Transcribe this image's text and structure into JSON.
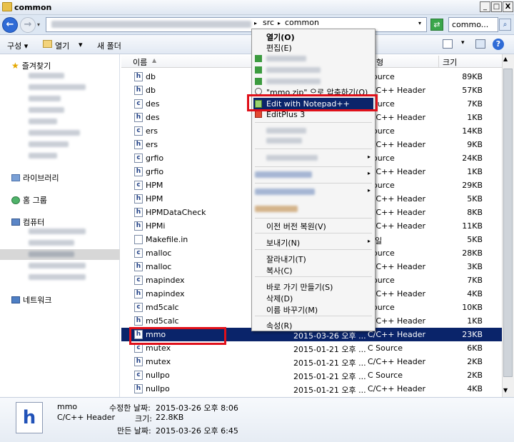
{
  "window": {
    "title": "common",
    "min": "_",
    "max": "□",
    "close": "X"
  },
  "address": {
    "crumb_src": "src",
    "crumb_common": "common",
    "search": "commo..."
  },
  "toolbar": {
    "organize": "구성 ▾",
    "open": "열기",
    "open_arrow": "▾",
    "new_folder": "새 폴더"
  },
  "sidebar": {
    "favorites": "즐겨찾기",
    "libraries": "라이브러리",
    "homegroup": "홈 그룹",
    "computer": "컴퓨터",
    "network": "네트워크"
  },
  "columns": {
    "name": "이름",
    "type": "형",
    "size": "크기"
  },
  "files": [
    {
      "icon": "h",
      "name": "db",
      "date": "",
      "type": "Source",
      "size": "89KB"
    },
    {
      "icon": "h",
      "name": "db",
      "date": "",
      "type": "C/C++ Header",
      "size": "57KB"
    },
    {
      "icon": "c",
      "name": "des",
      "date": "",
      "type": "Source",
      "size": "7KB"
    },
    {
      "icon": "h",
      "name": "des",
      "date": "",
      "type": "C/C++ Header",
      "size": "1KB"
    },
    {
      "icon": "c",
      "name": "ers",
      "date": "",
      "type": "Source",
      "size": "14KB"
    },
    {
      "icon": "h",
      "name": "ers",
      "date": "",
      "type": "C/C++ Header",
      "size": "9KB"
    },
    {
      "icon": "c",
      "name": "grfio",
      "date": "",
      "type": "Source",
      "size": "24KB"
    },
    {
      "icon": "h",
      "name": "grfio",
      "date": "",
      "type": "C/C++ Header",
      "size": "1KB"
    },
    {
      "icon": "c",
      "name": "HPM",
      "date": "",
      "type": "Source",
      "size": "29KB"
    },
    {
      "icon": "h",
      "name": "HPM",
      "date": "",
      "type": "C/C++ Header",
      "size": "5KB"
    },
    {
      "icon": "h",
      "name": "HPMDataCheck",
      "date": "",
      "type": "C/C++ Header",
      "size": "8KB"
    },
    {
      "icon": "h",
      "name": "HPMi",
      "date": "",
      "type": "C/C++ Header",
      "size": "11KB"
    },
    {
      "icon": "f",
      "name": "Makefile.in",
      "date": "",
      "type": "파일",
      "size": "5KB"
    },
    {
      "icon": "c",
      "name": "malloc",
      "date": "",
      "type": "Source",
      "size": "28KB"
    },
    {
      "icon": "h",
      "name": "malloc",
      "date": "",
      "type": "C/C++ Header",
      "size": "3KB"
    },
    {
      "icon": "c",
      "name": "mapindex",
      "date": "",
      "type": "Source",
      "size": "7KB"
    },
    {
      "icon": "h",
      "name": "mapindex",
      "date": "",
      "type": "C/C++ Header",
      "size": "4KB"
    },
    {
      "icon": "c",
      "name": "md5calc",
      "date": "",
      "type": "Source",
      "size": "10KB"
    },
    {
      "icon": "h",
      "name": "md5calc",
      "date": "",
      "type": "C/C++ Header",
      "size": "1KB"
    },
    {
      "icon": "h",
      "name": "mmo",
      "date": "2015-03-26 오후 ...",
      "type": "C/C++ Header",
      "size": "23KB"
    },
    {
      "icon": "c",
      "name": "mutex",
      "date": "2015-01-21 오후 ...",
      "type": "C Source",
      "size": "6KB"
    },
    {
      "icon": "h",
      "name": "mutex",
      "date": "2015-01-21 오후 ...",
      "type": "C/C++ Header",
      "size": "2KB"
    },
    {
      "icon": "c",
      "name": "nullpo",
      "date": "2015-01-21 오후 ...",
      "type": "C Source",
      "size": "2KB"
    },
    {
      "icon": "h",
      "name": "nullpo",
      "date": "2015-01-21 오후 ...",
      "type": "C/C++ Header",
      "size": "4KB"
    }
  ],
  "menu": {
    "open": "열기(O)",
    "edit": "편집(E)",
    "zip": "\"mmo.zip\" 으로 압축하기(Q)",
    "notepad": "Edit with Notepad++",
    "editplus": "EditPlus 3",
    "restore": "이전 버전 복원(V)",
    "sendto": "보내기(N)",
    "cut": "잘라내기(T)",
    "copy": "복사(C)",
    "shortcut": "바로 가기 만들기(S)",
    "delete": "삭제(D)",
    "rename": "이름 바꾸기(M)",
    "properties": "속성(R)"
  },
  "details": {
    "name": "mmo",
    "type": "C/C++ Header",
    "modified_label": "수정한 날짜:",
    "modified": "2015-03-26 오후 8:06",
    "size_label": "크기:",
    "size": "22.8KB",
    "created_label": "만든 날짜:",
    "created": "2015-03-26 오후 6:45"
  }
}
